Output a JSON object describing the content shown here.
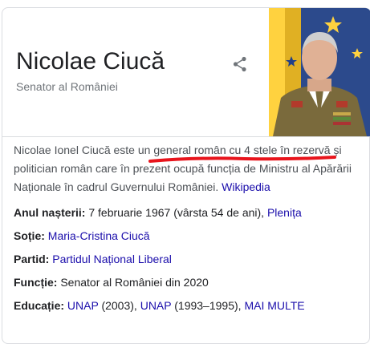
{
  "panel": {
    "title": "Nicolae Ciucă",
    "subtitle": "Senator al României"
  },
  "description": {
    "part1": "Nicolae Ionel Ciucă este un ",
    "highlight": "general român cu 4 stele în rezervă",
    "part2": " și politician român care în prezent ocupă funcția de Ministru al Apărării Naționale în cadrul Guvernului României. ",
    "source_link": "Wikipedia"
  },
  "facts": {
    "birth": {
      "label": "Anul nașterii:",
      "value": " 7 februarie 1967 (vârsta 54 de ani), ",
      "link": "Plenița"
    },
    "spouse": {
      "label": "Soție:",
      "link": "Maria-Cristina Ciucă"
    },
    "party": {
      "label": "Partid:",
      "link": "Partidul Național Liberal"
    },
    "function": {
      "label": "Funcție:",
      "value": " Senator al României din 2020"
    },
    "education": {
      "label": "Educație:",
      "link1": "UNAP",
      "sep1": " (2003), ",
      "link2": "UNAP",
      "sep2": " (1993–1995), ",
      "more": "MAI MULTE"
    }
  },
  "colors": {
    "link": "#1a0dab",
    "annotation_underline": "#e8141c"
  },
  "icons": {
    "share": "share-icon"
  }
}
